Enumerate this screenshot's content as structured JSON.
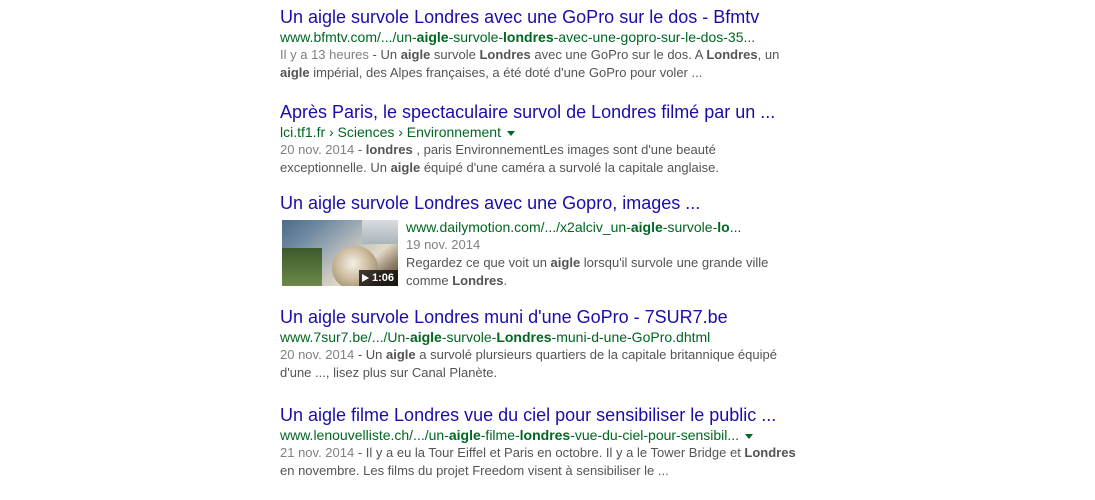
{
  "results": [
    {
      "title": "Un aigle survole Londres avec une GoPro sur le dos - Bfmtv",
      "url_parts": [
        {
          "text": "www.bfmtv.com/.../un-",
          "bold": false
        },
        {
          "text": "aigle",
          "bold": true
        },
        {
          "text": "-survole-",
          "bold": false
        },
        {
          "text": "londres",
          "bold": true
        },
        {
          "text": "-avec-une-gopro-sur-le-dos-35...",
          "bold": false
        }
      ],
      "has_menu": false,
      "date": "Il y a 13 heures",
      "snippet_parts": [
        {
          "text": " - Un ",
          "bold": false
        },
        {
          "text": "aigle",
          "bold": true
        },
        {
          "text": " survole ",
          "bold": false
        },
        {
          "text": "Londres",
          "bold": true
        },
        {
          "text": " avec une GoPro sur le dos. A ",
          "bold": false
        },
        {
          "text": "Londres",
          "bold": true
        },
        {
          "text": ", un ",
          "bold": false
        },
        {
          "text": "aigle",
          "bold": true
        },
        {
          "text": " impérial, des Alpes françaises, a été doté d'une GoPro pour voler ...",
          "bold": false
        }
      ]
    },
    {
      "title": "Après Paris, le spectaculaire survol de Londres filmé par un ...",
      "url_parts": [
        {
          "text": "lci.tf1.fr › Sciences › Environnement",
          "bold": false
        }
      ],
      "has_menu": true,
      "date": "20 nov. 2014",
      "snippet_parts": [
        {
          "text": " - ",
          "bold": false
        },
        {
          "text": "londres",
          "bold": true
        },
        {
          "text": " , paris EnvironnementLes images sont d'une beauté exceptionnelle. Un ",
          "bold": false
        },
        {
          "text": "aigle",
          "bold": true
        },
        {
          "text": " équipé d'une caméra a survolé la capitale anglaise.",
          "bold": false
        }
      ]
    },
    {
      "title": "Un aigle survole Londres avec une Gopro, images ...",
      "is_video": true,
      "video_duration": "1:06",
      "url_parts": [
        {
          "text": "www.dailymotion.com/.../x2alciv_un-",
          "bold": false
        },
        {
          "text": "aigle",
          "bold": true
        },
        {
          "text": "-survole-",
          "bold": false
        },
        {
          "text": "lo",
          "bold": true
        },
        {
          "text": "...",
          "bold": false
        }
      ],
      "has_menu": false,
      "date": "19 nov. 2014",
      "snippet_parts": [
        {
          "text": "Regardez ce que voit un ",
          "bold": false
        },
        {
          "text": "aigle",
          "bold": true
        },
        {
          "text": " lorsqu'il survole une grande ville comme ",
          "bold": false
        },
        {
          "text": "Londres",
          "bold": true
        },
        {
          "text": ".",
          "bold": false
        }
      ]
    },
    {
      "title": "Un aigle survole Londres muni d'une GoPro - 7SUR7.be",
      "url_parts": [
        {
          "text": "www.7sur7.be/.../Un-",
          "bold": false
        },
        {
          "text": "aigle",
          "bold": true
        },
        {
          "text": "-survole-",
          "bold": false
        },
        {
          "text": "Londres",
          "bold": true
        },
        {
          "text": "-muni-d-une-GoPro.dhtml",
          "bold": false
        }
      ],
      "has_menu": false,
      "date": "20 nov. 2014",
      "snippet_parts": [
        {
          "text": " - Un ",
          "bold": false
        },
        {
          "text": "aigle",
          "bold": true
        },
        {
          "text": " a survolé plursieurs quartiers de la capitale britannique équipé d'une ..., lisez plus sur Canal Planète.",
          "bold": false
        }
      ]
    },
    {
      "title": "Un aigle filme Londres vue du ciel pour sensibiliser le public ...",
      "url_parts": [
        {
          "text": "www.lenouvelliste.ch/.../un-",
          "bold": false
        },
        {
          "text": "aigle",
          "bold": true
        },
        {
          "text": "-filme-",
          "bold": false
        },
        {
          "text": "londres",
          "bold": true
        },
        {
          "text": "-vue-du-ciel-pour-sensibil...",
          "bold": false
        }
      ],
      "has_menu": true,
      "date": "21 nov. 2014",
      "snippet_parts": [
        {
          "text": " - Il y a eu la Tour Eiffel et Paris en octobre. Il y a le Tower Bridge et ",
          "bold": false
        },
        {
          "text": "Londres",
          "bold": true
        },
        {
          "text": " en novembre. Les films du projet Freedom visent à sensibiliser le ...",
          "bold": false
        }
      ]
    }
  ]
}
